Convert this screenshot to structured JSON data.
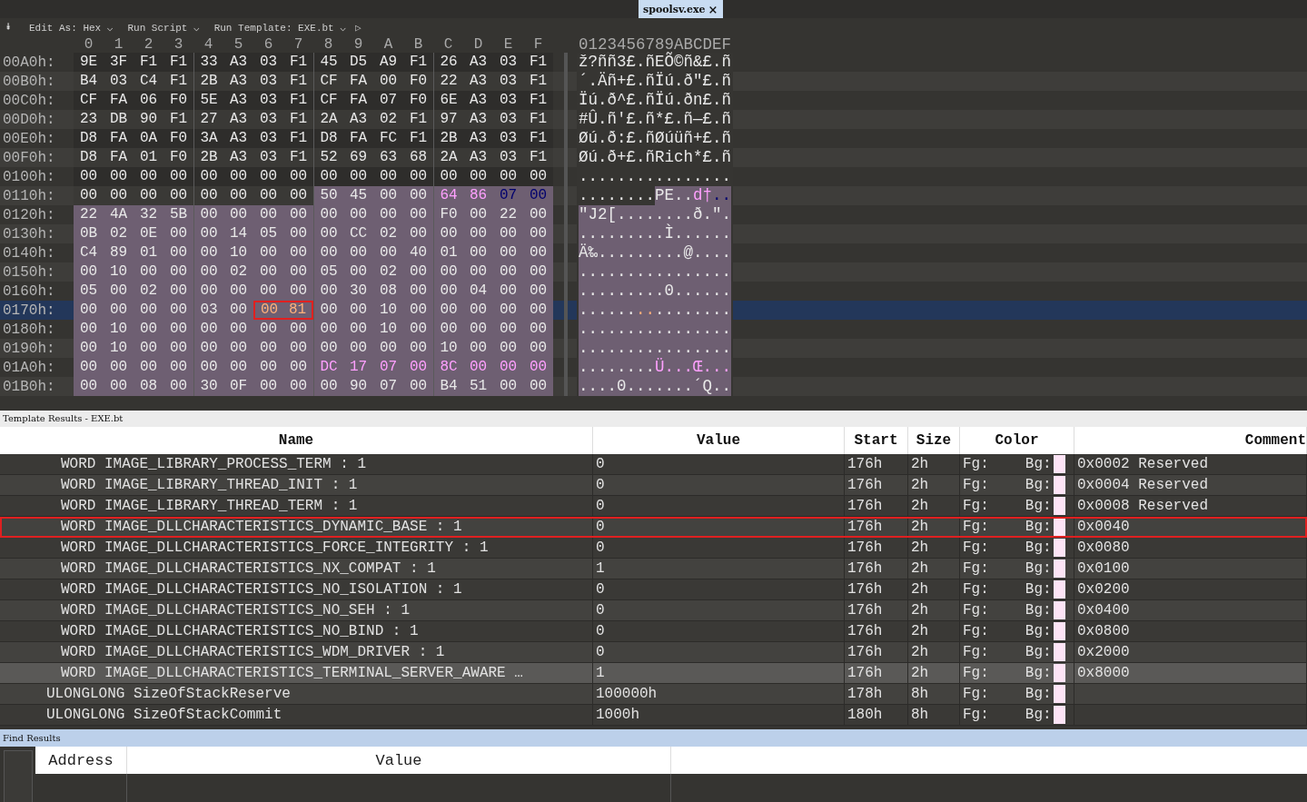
{
  "tab": {
    "title": "spoolsv.exe",
    "close": "×"
  },
  "toolbar": {
    "collapse": "⯯",
    "items": [
      {
        "label": "Edit As: Hex",
        "caret": "⌵"
      },
      {
        "label": "Run Script",
        "caret": "⌵"
      },
      {
        "label": "Run Template: EXE.bt",
        "caret": "⌵"
      }
    ],
    "run": "▷"
  },
  "hex_header": {
    "columns": [
      "0",
      "1",
      "2",
      "3",
      "4",
      "5",
      "6",
      "7",
      "8",
      "9",
      "A",
      "B",
      "C",
      "D",
      "E",
      "F"
    ],
    "ascii": "0123456789ABCDEF"
  },
  "hex_rows": [
    {
      "offset": "00A0h:",
      "current": false,
      "segments": [
        {
          "hex": [
            "9E",
            "3F",
            "F1",
            "F1",
            "33",
            "A3",
            "03",
            "F1",
            "45",
            "D5",
            "A9",
            "F1",
            "26",
            "A3",
            "03",
            "F1"
          ],
          "ascii": "ž?ññ3£.ñEÕ©ñ&£.ñ",
          "selected": false,
          "boxed": false
        }
      ]
    },
    {
      "offset": "00B0h:",
      "current": false,
      "segments": [
        {
          "hex": [
            "B4",
            "03",
            "C4",
            "F1",
            "2B",
            "A3",
            "03",
            "F1",
            "CF",
            "FA",
            "00",
            "F0",
            "22",
            "A3",
            "03",
            "F1"
          ],
          "ascii": "´.Äñ+£.ñÏú.ð\"£.ñ",
          "selected": false,
          "boxed": false
        }
      ]
    },
    {
      "offset": "00C0h:",
      "current": false,
      "segments": [
        {
          "hex": [
            "CF",
            "FA",
            "06",
            "F0",
            "5E",
            "A3",
            "03",
            "F1",
            "CF",
            "FA",
            "07",
            "F0",
            "6E",
            "A3",
            "03",
            "F1"
          ],
          "ascii": "Ïú.ð^£.ñÏú.ðn£.ñ",
          "selected": false,
          "boxed": false
        }
      ]
    },
    {
      "offset": "00D0h:",
      "current": false,
      "segments": [
        {
          "hex": [
            "23",
            "DB",
            "90",
            "F1",
            "27",
            "A3",
            "03",
            "F1",
            "2A",
            "A3",
            "02",
            "F1",
            "97",
            "A3",
            "03",
            "F1"
          ],
          "ascii": "#Û.ñ'£.ñ*£.ñ—£.ñ",
          "selected": false,
          "boxed": false
        }
      ]
    },
    {
      "offset": "00E0h:",
      "current": false,
      "segments": [
        {
          "hex": [
            "D8",
            "FA",
            "0A",
            "F0",
            "3A",
            "A3",
            "03",
            "F1",
            "D8",
            "FA",
            "FC",
            "F1",
            "2B",
            "A3",
            "03",
            "F1"
          ],
          "ascii": "Øú.ð:£.ñØúüñ+£.ñ",
          "selected": false,
          "boxed": false
        }
      ]
    },
    {
      "offset": "00F0h:",
      "current": false,
      "segments": [
        {
          "hex": [
            "D8",
            "FA",
            "01",
            "F0",
            "2B",
            "A3",
            "03",
            "F1",
            "52",
            "69",
            "63",
            "68",
            "2A",
            "A3",
            "03",
            "F1"
          ],
          "ascii": "Øú.ð+£.ñRich*£.ñ",
          "selected": false,
          "boxed": false
        }
      ]
    },
    {
      "offset": "0100h:",
      "current": false,
      "segments": [
        {
          "hex": [
            "00",
            "00",
            "00",
            "00",
            "00",
            "00",
            "00",
            "00",
            "00",
            "00",
            "00",
            "00",
            "00",
            "00",
            "00",
            "00"
          ],
          "ascii": "................",
          "selected": false,
          "boxed": false
        }
      ]
    },
    {
      "offset": "0110h:",
      "current": false,
      "segments": [
        {
          "hex": [
            "00",
            "00",
            "00",
            "00",
            "00",
            "00",
            "00",
            "00"
          ],
          "ascii": "........",
          "selected": false,
          "boxed": false
        },
        {
          "hex": [
            "50",
            "45",
            "00",
            "00"
          ],
          "ascii": "PE..",
          "selected": true,
          "boxed": false
        },
        {
          "hex": [
            "64",
            "86"
          ],
          "ascii": "d†",
          "selected": true,
          "boxed": false,
          "color": "#ffa0ff"
        },
        {
          "hex": [
            "07",
            "00"
          ],
          "ascii": "..",
          "selected": true,
          "boxed": false,
          "color": "#00006e"
        }
      ]
    },
    {
      "offset": "0120h:",
      "current": false,
      "segments": [
        {
          "hex": [
            "22",
            "4A",
            "32",
            "5B",
            "00",
            "00",
            "00",
            "00",
            "00",
            "00",
            "00",
            "00",
            "F0",
            "00",
            "22",
            "00"
          ],
          "ascii": "\"J2[........ð.\".",
          "selected": true,
          "boxed": false
        }
      ]
    },
    {
      "offset": "0130h:",
      "current": false,
      "segments": [
        {
          "hex": [
            "0B",
            "02",
            "0E",
            "00",
            "00",
            "14",
            "05",
            "00",
            "00",
            "CC",
            "02",
            "00",
            "00",
            "00",
            "00",
            "00"
          ],
          "ascii": ".........Ì......",
          "selected": true,
          "boxed": false
        }
      ]
    },
    {
      "offset": "0140h:",
      "current": false,
      "segments": [
        {
          "hex": [
            "C4",
            "89",
            "01",
            "00",
            "00",
            "10",
            "00",
            "00",
            "00",
            "00",
            "00",
            "40",
            "01",
            "00",
            "00",
            "00"
          ],
          "ascii": "Ä‰.........@....",
          "selected": true,
          "boxed": false
        }
      ]
    },
    {
      "offset": "0150h:",
      "current": false,
      "segments": [
        {
          "hex": [
            "00",
            "10",
            "00",
            "00",
            "00",
            "02",
            "00",
            "00",
            "05",
            "00",
            "02",
            "00",
            "00",
            "00",
            "00",
            "00"
          ],
          "ascii": "................",
          "selected": true,
          "boxed": false
        }
      ]
    },
    {
      "offset": "0160h:",
      "current": false,
      "segments": [
        {
          "hex": [
            "05",
            "00",
            "02",
            "00",
            "00",
            "00",
            "00",
            "00",
            "00",
            "30",
            "08",
            "00",
            "00",
            "04",
            "00",
            "00"
          ],
          "ascii": ".........0......",
          "selected": true,
          "boxed": false
        }
      ]
    },
    {
      "offset": "0170h:",
      "current": true,
      "segments": [
        {
          "hex": [
            "00",
            "00",
            "00",
            "00",
            "03",
            "00"
          ],
          "ascii": "......",
          "selected": true,
          "boxed": false
        },
        {
          "hex": [
            "00",
            "81"
          ],
          "ascii": "..",
          "selected": true,
          "boxed": true,
          "color": "#ffb07a"
        },
        {
          "hex": [
            "00",
            "00",
            "10",
            "00",
            "00",
            "00",
            "00",
            "00"
          ],
          "ascii": "........",
          "selected": true,
          "boxed": false
        }
      ]
    },
    {
      "offset": "0180h:",
      "current": false,
      "segments": [
        {
          "hex": [
            "00",
            "10",
            "00",
            "00",
            "00",
            "00",
            "00",
            "00",
            "00",
            "00",
            "10",
            "00",
            "00",
            "00",
            "00",
            "00"
          ],
          "ascii": "................",
          "selected": true,
          "boxed": false
        }
      ]
    },
    {
      "offset": "0190h:",
      "current": false,
      "segments": [
        {
          "hex": [
            "00",
            "10",
            "00",
            "00",
            "00",
            "00",
            "00",
            "00",
            "00",
            "00",
            "00",
            "00",
            "10",
            "00",
            "00",
            "00"
          ],
          "ascii": "................",
          "selected": true,
          "boxed": false
        }
      ]
    },
    {
      "offset": "01A0h:",
      "current": false,
      "segments": [
        {
          "hex": [
            "00",
            "00",
            "00",
            "00",
            "00",
            "00",
            "00",
            "00"
          ],
          "ascii": "........",
          "selected": true,
          "boxed": false
        },
        {
          "hex": [
            "DC",
            "17",
            "07",
            "00",
            "8C",
            "00",
            "00",
            "00"
          ],
          "ascii": "Ü...Œ...",
          "selected": true,
          "boxed": false,
          "color": "#ffa0ff"
        }
      ]
    },
    {
      "offset": "01B0h:",
      "current": false,
      "segments": [
        {
          "hex": [
            "00",
            "00",
            "08",
            "00",
            "30",
            "0F",
            "00",
            "00",
            "00",
            "90",
            "07",
            "00",
            "B4",
            "51",
            "00",
            "00"
          ],
          "ascii": "....0.......´Q..",
          "selected": true,
          "boxed": false
        }
      ]
    }
  ],
  "template_results": {
    "title": "Template Results - EXE.bt",
    "columns": [
      "Name",
      "Value",
      "Start",
      "Size",
      "Color",
      "Comment"
    ],
    "rows": [
      {
        "kind": "flag",
        "name": "WORD IMAGE_LIBRARY_PROCESS_TERM : 1",
        "value": "0",
        "start": "176h",
        "size": "2h",
        "fg": "Fg:",
        "bg": "Bg:",
        "comment": "0x0002 Reserved",
        "selected": false,
        "boxed": false
      },
      {
        "kind": "flag",
        "name": "WORD IMAGE_LIBRARY_THREAD_INIT : 1",
        "value": "0",
        "start": "176h",
        "size": "2h",
        "fg": "Fg:",
        "bg": "Bg:",
        "comment": "0x0004 Reserved",
        "selected": false,
        "boxed": false
      },
      {
        "kind": "flag",
        "name": "WORD IMAGE_LIBRARY_THREAD_TERM : 1",
        "value": "0",
        "start": "176h",
        "size": "2h",
        "fg": "Fg:",
        "bg": "Bg:",
        "comment": "0x0008 Reserved",
        "selected": false,
        "boxed": false
      },
      {
        "kind": "flag",
        "name": "WORD IMAGE_DLLCHARACTERISTICS_DYNAMIC_BASE : 1",
        "value": "0",
        "start": "176h",
        "size": "2h",
        "fg": "Fg:",
        "bg": "Bg:",
        "comment": "0x0040",
        "selected": false,
        "boxed": true
      },
      {
        "kind": "flag",
        "name": "WORD IMAGE_DLLCHARACTERISTICS_FORCE_INTEGRITY : 1",
        "value": "0",
        "start": "176h",
        "size": "2h",
        "fg": "Fg:",
        "bg": "Bg:",
        "comment": "0x0080",
        "selected": false,
        "boxed": false
      },
      {
        "kind": "flag",
        "name": "WORD IMAGE_DLLCHARACTERISTICS_NX_COMPAT : 1",
        "value": "1",
        "start": "176h",
        "size": "2h",
        "fg": "Fg:",
        "bg": "Bg:",
        "comment": "0x0100",
        "selected": false,
        "boxed": false
      },
      {
        "kind": "flag",
        "name": "WORD IMAGE_DLLCHARACTERISTICS_NO_ISOLATION : 1",
        "value": "0",
        "start": "176h",
        "size": "2h",
        "fg": "Fg:",
        "bg": "Bg:",
        "comment": "0x0200",
        "selected": false,
        "boxed": false
      },
      {
        "kind": "flag",
        "name": "WORD IMAGE_DLLCHARACTERISTICS_NO_SEH : 1",
        "value": "0",
        "start": "176h",
        "size": "2h",
        "fg": "Fg:",
        "bg": "Bg:",
        "comment": "0x0400",
        "selected": false,
        "boxed": false
      },
      {
        "kind": "flag",
        "name": "WORD IMAGE_DLLCHARACTERISTICS_NO_BIND : 1",
        "value": "0",
        "start": "176h",
        "size": "2h",
        "fg": "Fg:",
        "bg": "Bg:",
        "comment": "0x0800",
        "selected": false,
        "boxed": false
      },
      {
        "kind": "flag",
        "name": "WORD IMAGE_DLLCHARACTERISTICS_WDM_DRIVER : 1",
        "value": "0",
        "start": "176h",
        "size": "2h",
        "fg": "Fg:",
        "bg": "Bg:",
        "comment": "0x2000",
        "selected": false,
        "boxed": false
      },
      {
        "kind": "flag",
        "name": "WORD IMAGE_DLLCHARACTERISTICS_TERMINAL_SERVER_AWARE …",
        "value": "1",
        "start": "176h",
        "size": "2h",
        "fg": "Fg:",
        "bg": "Bg:",
        "comment": "0x8000",
        "selected": true,
        "boxed": false
      },
      {
        "kind": "field",
        "name": "ULONGLONG SizeOfStackReserve",
        "value": "100000h",
        "start": "178h",
        "size": "8h",
        "fg": "Fg:",
        "bg": "Bg:",
        "selected": false,
        "boxed": false
      },
      {
        "kind": "field",
        "name": "ULONGLONG SizeOfStackCommit",
        "value": "1000h",
        "start": "180h",
        "size": "8h",
        "fg": "Fg:",
        "bg": "Bg:",
        "selected": false,
        "boxed": false
      }
    ]
  },
  "find_results": {
    "title": "Find Results",
    "columns": [
      "Address",
      "Value"
    ]
  }
}
